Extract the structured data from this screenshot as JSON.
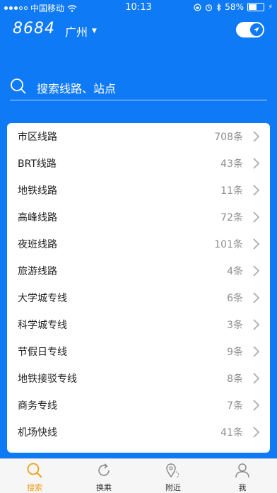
{
  "status_bar": {
    "carrier": "中国移动",
    "time": "10:13",
    "battery": "58%"
  },
  "header": {
    "logo": "8684",
    "city": "广州"
  },
  "search": {
    "placeholder": "搜索线路、站点"
  },
  "categories": [
    {
      "label": "市区线路",
      "count": "708条"
    },
    {
      "label": "BRT线路",
      "count": "43条"
    },
    {
      "label": "地铁线路",
      "count": "11条"
    },
    {
      "label": "高峰线路",
      "count": "72条"
    },
    {
      "label": "夜班线路",
      "count": "101条"
    },
    {
      "label": "旅游线路",
      "count": "4条"
    },
    {
      "label": "大学城专线",
      "count": "6条"
    },
    {
      "label": "科学城专线",
      "count": "3条"
    },
    {
      "label": "节假日专线",
      "count": "9条"
    },
    {
      "label": "地铁接驳专线",
      "count": "8条"
    },
    {
      "label": "商务专线",
      "count": "7条"
    },
    {
      "label": "机场快线",
      "count": "41条"
    }
  ],
  "tabs": [
    {
      "label": "搜索",
      "icon": "search-icon",
      "active": true
    },
    {
      "label": "换乘",
      "icon": "refresh-icon",
      "active": false
    },
    {
      "label": "附近",
      "icon": "location-pin-icon",
      "active": false
    },
    {
      "label": "我",
      "icon": "user-icon",
      "active": false
    }
  ],
  "colors": {
    "primary": "#0f7af5",
    "active_tab": "#f0a020"
  }
}
